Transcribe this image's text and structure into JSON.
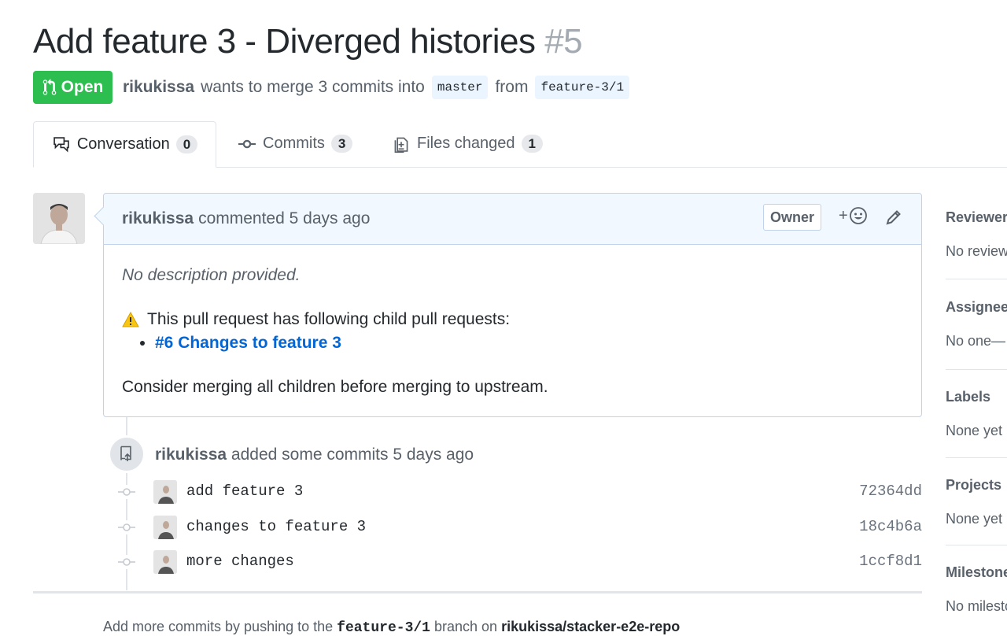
{
  "title": {
    "text": "Add feature 3 - Diverged histories",
    "number": "#5"
  },
  "state": {
    "label": "Open",
    "color": "#2cbe4e"
  },
  "meta": {
    "author": "rikukissa",
    "wants_text": "wants to merge 3 commits into",
    "base_branch": "master",
    "from_text": "from",
    "head_branch": "feature-3/1"
  },
  "tabs": [
    {
      "label": "Conversation",
      "count": "0",
      "icon": "comment-discussion-icon"
    },
    {
      "label": "Commits",
      "count": "3",
      "icon": "git-commit-icon"
    },
    {
      "label": "Files changed",
      "count": "1",
      "icon": "file-diff-icon"
    }
  ],
  "comment": {
    "author": "rikukissa",
    "action": "commented 5 days ago",
    "owner_label": "Owner",
    "no_description": "No description provided.",
    "warning": "This pull request has following child pull requests:",
    "child_link": "#6 Changes to feature 3",
    "consider": "Consider merging all children before merging to upstream."
  },
  "timeline": {
    "push_author": "rikukissa",
    "push_text": "added some commits 5 days ago",
    "commits": [
      {
        "message": "add feature 3",
        "sha": "72364dd"
      },
      {
        "message": "changes to feature 3",
        "sha": "18c4b6a"
      },
      {
        "message": "more changes",
        "sha": "1ccf8d1"
      }
    ]
  },
  "footer_hint": {
    "prefix": "Add more commits by pushing to the",
    "branch": "feature-3/1",
    "middle": "branch on",
    "repo": "rikukissa/stacker-e2e-repo"
  },
  "sidebar": [
    {
      "heading": "Reviewers",
      "value": "No reviewers"
    },
    {
      "heading": "Assignees",
      "value": "No one—"
    },
    {
      "heading": "Labels",
      "value": "None yet"
    },
    {
      "heading": "Projects",
      "value": "None yet"
    },
    {
      "heading": "Milestone",
      "value": "No milestone"
    }
  ],
  "colors": {
    "link": "#0366d6",
    "open_green": "#2cbe4e",
    "comment_header_bg": "#f1f8ff"
  }
}
